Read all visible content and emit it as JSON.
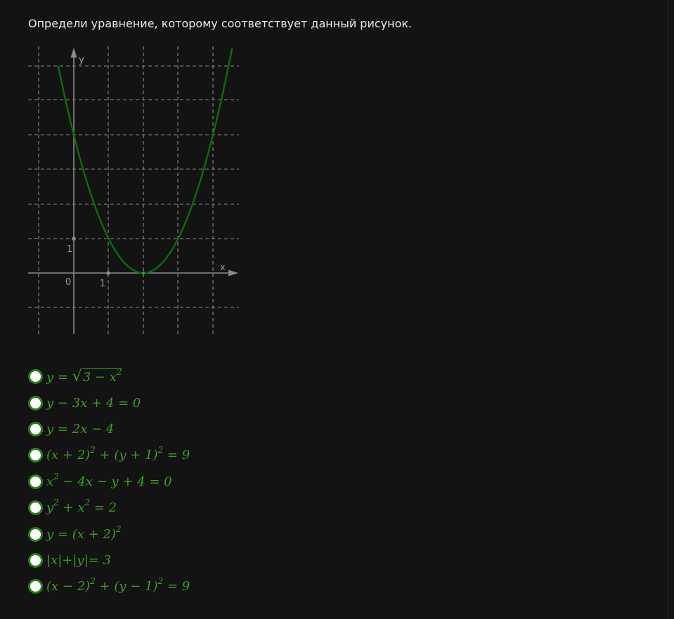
{
  "question": {
    "text": "Определи уравнение, которому соответствует данный рисунок."
  },
  "graph": {
    "x_axis_label": "x",
    "y_axis_label": "y",
    "origin_label": "0",
    "x_tick_label": "1",
    "y_tick_label": "1",
    "curve_color": "#0d6b0d",
    "grid_color": "#8a8a8a",
    "axis_color": "#8a8a8a",
    "function": "(x - 2)^2",
    "x_range": [
      -1,
      4.7
    ],
    "y_range": [
      -1.7,
      6.5
    ]
  },
  "options": [
    {
      "id": "opt1",
      "f": {
        "a": "y",
        "b": " = ",
        "rad": "√",
        "c": "3 − x",
        "sup": "2"
      }
    },
    {
      "id": "opt2",
      "f": {
        "a": "y − 3x + 4 = 0"
      }
    },
    {
      "id": "opt3",
      "f": {
        "a": "y = 2x − 4"
      }
    },
    {
      "id": "opt4",
      "f": {
        "a": "(x + 2)",
        "s1": "2",
        "b": " + (y + 1)",
        "s2": "2",
        "c": " = 9"
      }
    },
    {
      "id": "opt5",
      "f": {
        "a": "x",
        "s1": "2",
        "b": " − 4x − y + 4 = 0"
      }
    },
    {
      "id": "opt6",
      "f": {
        "a": "y",
        "s1": "2",
        "b": " + x",
        "s2": "2",
        "c": " = 2"
      }
    },
    {
      "id": "opt7",
      "f": {
        "a": "y = (x + 2)",
        "s1": "2"
      }
    },
    {
      "id": "opt8",
      "f": {
        "a": "|x|+|y|= 3"
      }
    },
    {
      "id": "opt9",
      "f": {
        "a": "(x − 2)",
        "s1": "2",
        "b": " + (y − 1)",
        "s2": "2",
        "c": " = 9"
      }
    }
  ],
  "colors": {
    "background": "#131313",
    "formula": "#3f9a2c",
    "radio_border": "#2e7d1e"
  }
}
